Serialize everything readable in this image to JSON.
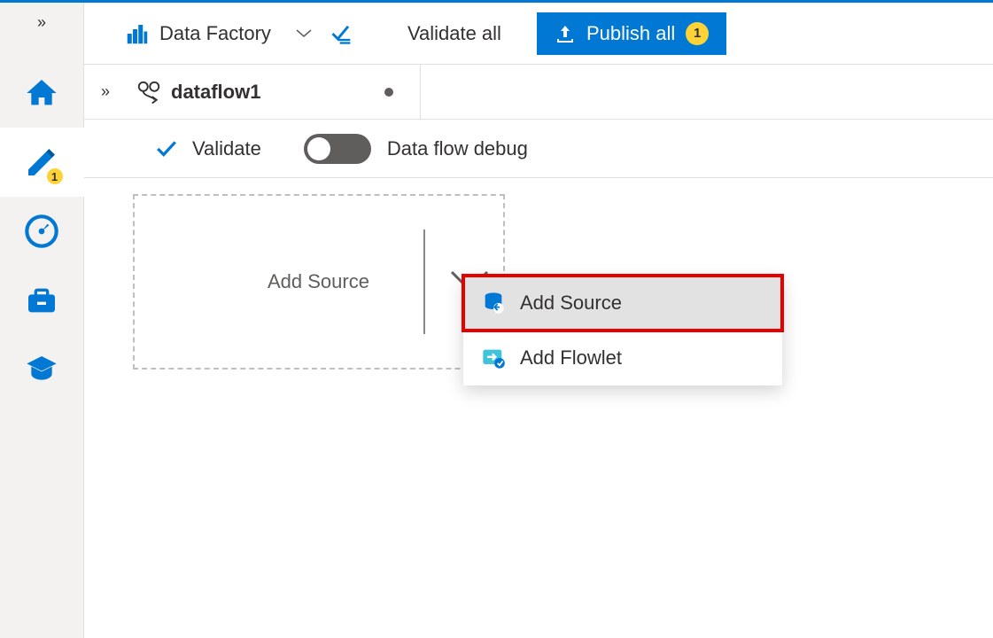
{
  "leftNav": {
    "authorBadge": "1"
  },
  "toolbar": {
    "factoryLabel": "Data Factory",
    "validateAllLabel": "Validate all",
    "publishLabel": "Publish all",
    "publishBadge": "1"
  },
  "tab": {
    "name": "dataflow1"
  },
  "actionBar": {
    "validateLabel": "Validate",
    "debugLabel": "Data flow debug"
  },
  "canvas": {
    "addSourceLabel": "Add Source"
  },
  "menu": {
    "addSourceLabel": "Add Source",
    "addFlowletLabel": "Add Flowlet"
  }
}
